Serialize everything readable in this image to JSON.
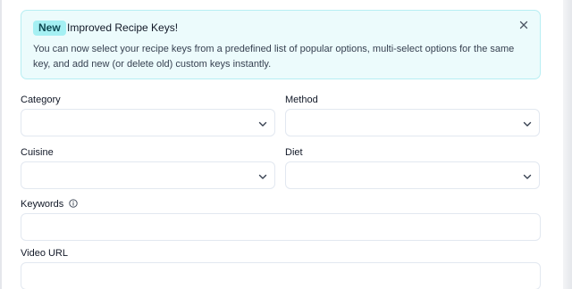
{
  "banner": {
    "badge": "New",
    "title": "Improved Recipe Keys!",
    "body": "You can now select your recipe keys from a predefined list of popular options, multi-select options for the same key, and add new (or delete old) custom keys instantly."
  },
  "form": {
    "category": {
      "label": "Category",
      "value": ""
    },
    "method": {
      "label": "Method",
      "value": ""
    },
    "cuisine": {
      "label": "Cuisine",
      "value": ""
    },
    "diet": {
      "label": "Diet",
      "value": ""
    },
    "keywords": {
      "label": "Keywords",
      "value": ""
    },
    "video_url": {
      "label": "Video URL",
      "value": ""
    }
  },
  "icons": {
    "close": "close-icon",
    "chevron": "chevron-down-icon",
    "info": "info-icon"
  },
  "colors": {
    "banner_bg": "#ecfbfc",
    "banner_border": "#b7eef3",
    "badge_bg": "#a5f0f3",
    "badge_text": "#0e4a53",
    "field_border": "#e2e8f0"
  }
}
